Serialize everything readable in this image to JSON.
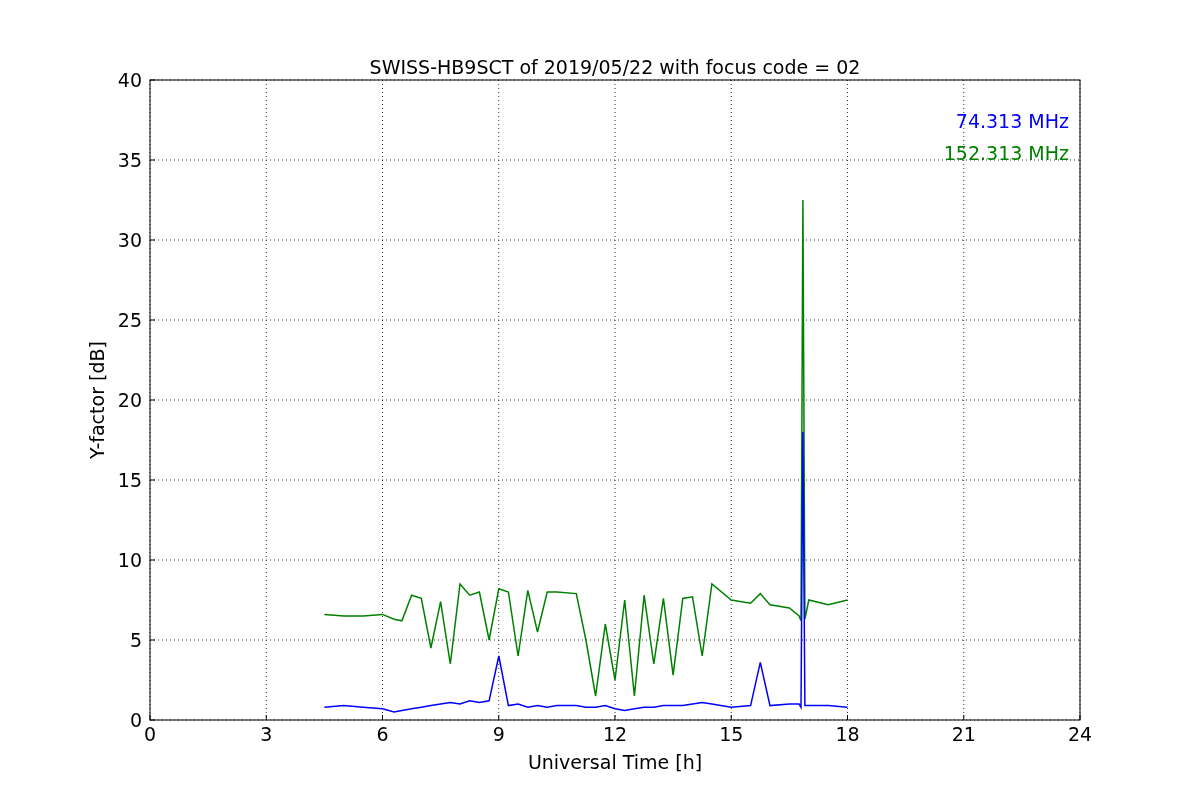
{
  "plot": {
    "chart_data": {
      "type": "line",
      "title": "SWISS-HB9SCT of 2019/05/22 with focus code = 02",
      "xlabel": "Universal Time [h]",
      "ylabel": "Y-factor [dB]",
      "x": [
        4.5,
        5,
        5.5,
        6,
        6.3,
        6.5,
        6.75,
        7,
        7.25,
        7.5,
        7.75,
        8,
        8.25,
        8.5,
        8.75,
        9,
        9.25,
        9.5,
        9.75,
        10,
        10.25,
        10.5,
        11,
        11.25,
        11.5,
        11.75,
        12,
        12.25,
        12.5,
        12.75,
        13,
        13.25,
        13.5,
        13.75,
        14,
        14.25,
        14.5,
        15,
        15.5,
        15.75,
        16,
        16.5,
        16.75,
        16.8,
        16.85,
        16.9,
        17,
        17.5,
        18
      ],
      "series": [
        {
          "name": "74.313 MHz",
          "color": "#0000ff",
          "values": [
            0.8,
            0.9,
            0.8,
            0.7,
            0.5,
            0.6,
            0.7,
            0.8,
            0.9,
            1.0,
            1.1,
            1.0,
            1.2,
            1.1,
            1.2,
            4.0,
            0.9,
            1.0,
            0.8,
            0.9,
            0.8,
            0.9,
            0.9,
            0.8,
            0.8,
            0.9,
            0.7,
            0.6,
            0.7,
            0.8,
            0.8,
            0.9,
            0.9,
            0.9,
            1.0,
            1.1,
            1.0,
            0.8,
            0.9,
            3.6,
            0.9,
            1.0,
            1.0,
            0.8,
            18.0,
            0.9,
            0.9,
            0.9,
            0.8
          ]
        },
        {
          "name": "152.313 MHz",
          "color": "#008000",
          "values": [
            6.6,
            6.5,
            6.5,
            6.6,
            6.3,
            6.2,
            7.8,
            7.6,
            4.5,
            7.4,
            3.5,
            8.5,
            7.8,
            8.0,
            5.0,
            8.2,
            8.0,
            4.0,
            8.1,
            5.5,
            8.0,
            8.0,
            7.9,
            5.0,
            1.5,
            6.0,
            2.5,
            7.5,
            1.5,
            7.8,
            3.5,
            7.6,
            2.8,
            7.6,
            7.7,
            4.0,
            8.5,
            7.5,
            7.3,
            7.9,
            7.2,
            7.0,
            6.5,
            6.2,
            32.5,
            6.3,
            7.5,
            7.2,
            7.5
          ]
        }
      ],
      "grid": true,
      "xlim": [
        0,
        24
      ],
      "ylim": [
        0,
        40
      ],
      "xticks": [
        0,
        3,
        6,
        9,
        12,
        15,
        18,
        21,
        24
      ],
      "yticks": [
        0,
        5,
        10,
        15,
        20,
        25,
        30,
        35,
        40
      ]
    }
  }
}
